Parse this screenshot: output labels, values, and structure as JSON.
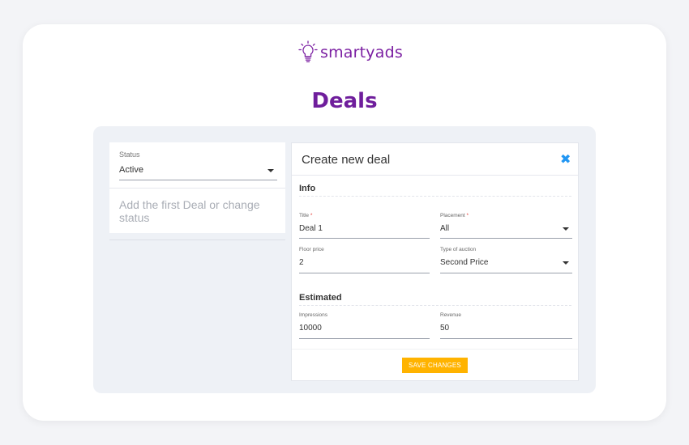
{
  "brand": {
    "name": "smartyads",
    "color": "#7b1fa2"
  },
  "page": {
    "title": "Deals",
    "title_color": "#6f1e9c"
  },
  "status_filter": {
    "label": "Status",
    "value": "Active"
  },
  "deals_list": {
    "empty_message": "Add the first Deal or change status"
  },
  "create_deal": {
    "title": "Create new deal",
    "close_icon": "close-icon",
    "info_section": {
      "title": "Info",
      "title_field": {
        "label": "Title",
        "required": "*",
        "value": "Deal 1"
      },
      "placement_field": {
        "label": "Placement",
        "required": "*",
        "value": "All"
      },
      "floor_price_field": {
        "label": "Floor price",
        "value": "2"
      },
      "auction_type_field": {
        "label": "Type of auction",
        "value": "Second Price"
      }
    },
    "estimated_section": {
      "title": "Estimated",
      "impressions_field": {
        "label": "Impressions",
        "value": "10000"
      },
      "revenue_field": {
        "label": "Revenue",
        "value": "50"
      }
    },
    "save_button": {
      "label": "SAVE CHANGES",
      "color": "#ffb300"
    }
  },
  "colors": {
    "accent": "#2196f3",
    "panel_bg": "#eef1f6"
  }
}
